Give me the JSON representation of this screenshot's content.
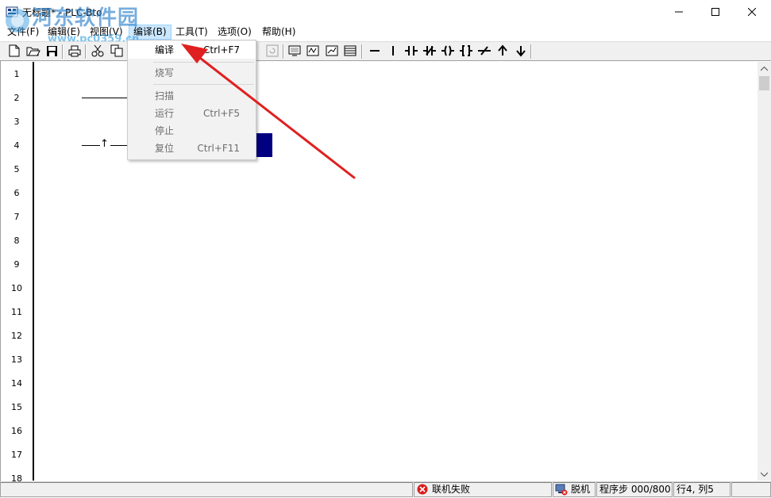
{
  "window": {
    "title": "无标题* - PLC-Bto",
    "minimize": "—",
    "maximize": "☐",
    "close": "✕"
  },
  "watermark": {
    "text": "河东软件园",
    "url": "www.pc0359.cn"
  },
  "menubar": {
    "items": [
      {
        "label": "文件(F)"
      },
      {
        "label": "编辑(E)"
      },
      {
        "label": "视图(V)"
      },
      {
        "label": "编译(B)"
      },
      {
        "label": "工具(T)"
      },
      {
        "label": "选项(O)"
      },
      {
        "label": "帮助(H)"
      }
    ]
  },
  "dropdown": {
    "items": [
      {
        "label": "编译",
        "shortcut": "Ctrl+F7",
        "enabled": true
      },
      {
        "label": "烧写",
        "shortcut": "",
        "enabled": false
      },
      {
        "label": "扫描",
        "shortcut": "",
        "enabled": false
      },
      {
        "label": "运行",
        "shortcut": "Ctrl+F5",
        "enabled": false
      },
      {
        "label": "停止",
        "shortcut": "",
        "enabled": false
      },
      {
        "label": "复位",
        "shortcut": "Ctrl+F11",
        "enabled": false
      }
    ]
  },
  "toolbar": {
    "ladder_symbols": [
      "—",
      "|",
      "-||-",
      "-|/|-",
      "-( )-",
      "-[ ]-",
      "-/-",
      "↑",
      "↓"
    ]
  },
  "editor": {
    "line_numbers": [
      "1",
      "2",
      "3",
      "4",
      "5",
      "6",
      "7",
      "8",
      "9",
      "10",
      "11",
      "12",
      "13",
      "14",
      "15",
      "16",
      "17",
      "18"
    ],
    "rung4_symbol": "↑"
  },
  "statusbar": {
    "connection": "联机失败",
    "mode": "脱机",
    "steps": "程序步 000/800",
    "position": "行4, 列5"
  },
  "colors": {
    "cursor": "#000080",
    "menu_highlight": "#cce8ff",
    "arrow": "#e02020"
  }
}
